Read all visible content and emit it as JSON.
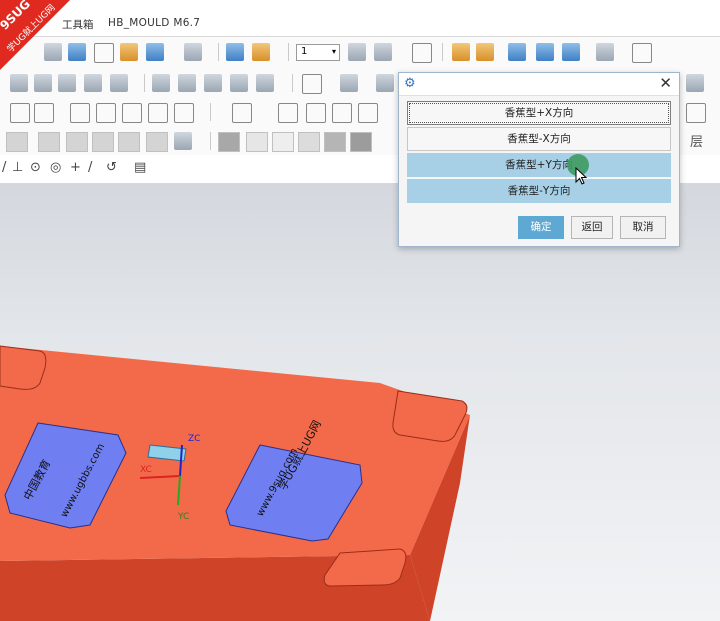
{
  "title_bar": {
    "menu_label": "工具箱",
    "app_title": "HB_MOULD M6.7",
    "watermark": "9SUG 学UG就上UG网"
  },
  "toolbar": {
    "layer_value": "1",
    "layer_category_label": "层"
  },
  "dialog": {
    "options": [
      "香蕉型+X方向",
      "香蕉型-X方向",
      "香蕉型+Y方向",
      "香蕉型-Y方向"
    ],
    "ok_label": "确定",
    "back_label": "返回",
    "cancel_label": "取消"
  },
  "model": {
    "plate_left_lines": [
      "中国教育",
      "www.ugbbs.com"
    ],
    "plate_right_lines": [
      "学UG就上UG网",
      "www.9sug.com"
    ],
    "axis_labels": {
      "zc": "ZC",
      "xc": "XC",
      "yc": "YC"
    },
    "colors": {
      "plate_top": "#f36a4a",
      "plate_side": "#cf4328",
      "insert_blue": "#6f7ff2"
    }
  }
}
